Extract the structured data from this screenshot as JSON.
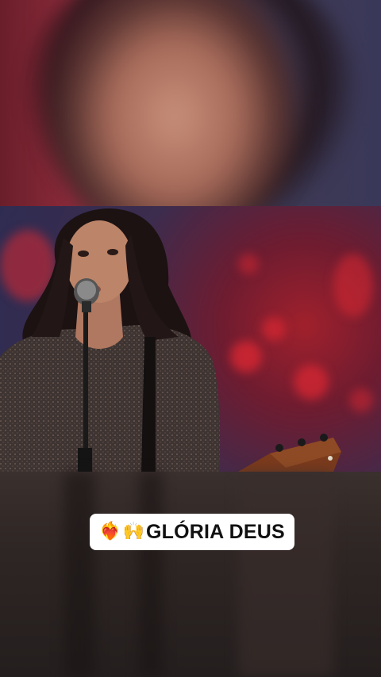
{
  "caption": {
    "emoji_heart": "❤️‍🔥",
    "emoji_hands": "🙌",
    "text": "GLÓRIA DEUS"
  },
  "colors": {
    "stage_backdrop_red": "#8a2a3a",
    "stage_backdrop_blue": "#2e2c52",
    "caption_background": "#ffffff",
    "caption_text": "#111111"
  }
}
